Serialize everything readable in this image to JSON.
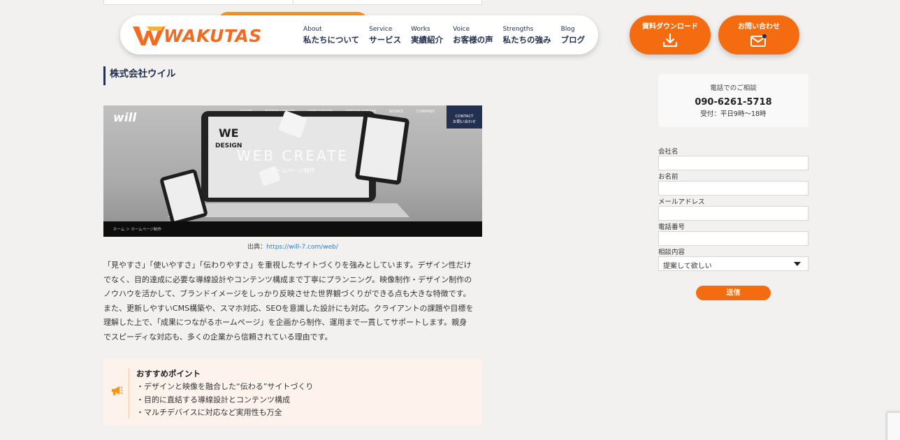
{
  "header": {
    "logo_text": "WAKUTAS",
    "nav": [
      {
        "en": "About",
        "ja": "私たちについて"
      },
      {
        "en": "Service",
        "ja": "サービス"
      },
      {
        "en": "Works",
        "ja": "実績紹介"
      },
      {
        "en": "Voice",
        "ja": "お客様の声"
      },
      {
        "en": "Strengths",
        "ja": "私たちの強み"
      },
      {
        "en": "Blog",
        "ja": "ブログ"
      }
    ],
    "cta_download": "資料ダウンロード",
    "cta_contact": "お問い合わせ"
  },
  "main": {
    "company_name": "株式会社ウイル",
    "hero": {
      "brand": "will",
      "menu": [
        "HOME",
        "WORKS CREATE",
        "WEB CREATE",
        "DESIGN CREATE",
        "WORKS",
        "COMPANY"
      ],
      "contact_en": "CONTACT",
      "contact_ja": "お問い合わせ",
      "title": "WEB CREATE",
      "subtitle": "ホームページ制作",
      "breadcrumb": "ホーム ＞ ホームページ制作"
    },
    "caption_prefix": "出典：",
    "caption_link": "https://will-7.com/web/",
    "body_lines": [
      "「見やすさ」「使いやすさ」「伝わりやすさ」を重視したサイトづくりを強みとしています。デザイン性だけ",
      "でなく、目的達成に必要な導線設計やコンテンツ構成まで丁寧にプランニング。映像制作・デザイン制作の",
      "ノウハウを活かして、ブランドイメージをしっかり反映させた世界観づくりができる点も大きな特徴です。",
      "また、更新しやすいCMS構築や、スマホ対応、SEOを意識した設計にも対応。クライアントの課題や目標を",
      "理解した上で、「成果につながるホームページ」を企画から制作、運用まで一貫してサポートします。親身",
      "でスピーディな対応も、多くの企業から信頼されている理由です。"
    ],
    "points_title": "おすすめポイント",
    "points": [
      "・デザインと映像を融合した“伝わる”サイトづくり",
      "・目的に直結する導線設計とコンテンツ構成",
      "・マルチデバイスに対応など実用性も万全"
    ]
  },
  "sidebar": {
    "tel_label": "電話でのご相談",
    "tel_number": "090-6261-5718",
    "tel_hours": "受付：平日9時〜18時",
    "form": {
      "company_label": "会社名",
      "name_label": "お名前",
      "email_label": "メールアドレス",
      "phone_label": "電話番号",
      "topic_label": "相談内容",
      "topic_value": "提案して欲しい",
      "submit_label": "送信"
    }
  },
  "colors": {
    "accent": "#f46c0f",
    "navy": "#23304f",
    "background": "#f2f1ef"
  }
}
